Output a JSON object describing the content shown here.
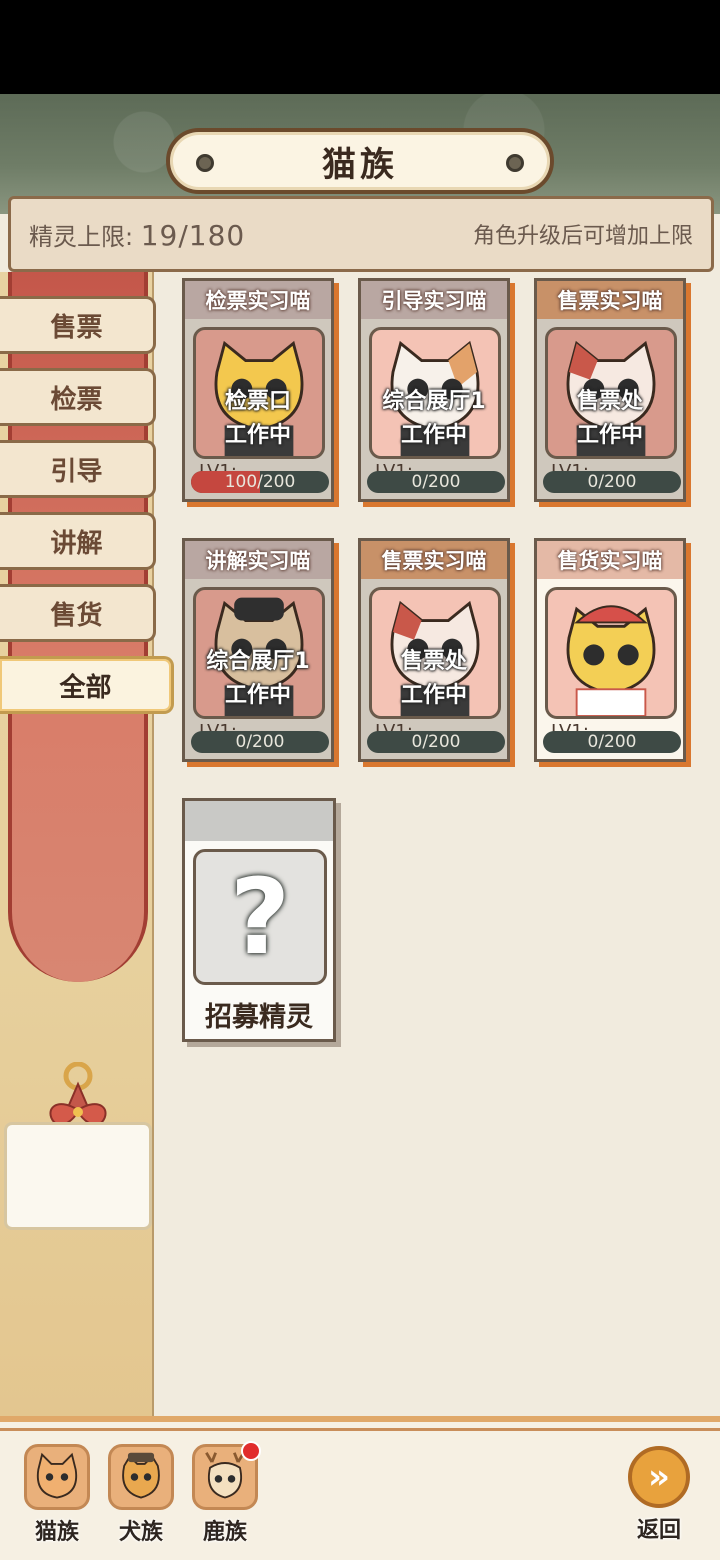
{
  "header": {
    "title": "猫族",
    "limit_label": "精灵上限:",
    "limit_value": "19/180",
    "limit_hint": "角色升级后可增加上限"
  },
  "sidebar": {
    "tabs": [
      {
        "label": "售票"
      },
      {
        "label": "检票"
      },
      {
        "label": "引导"
      },
      {
        "label": "讲解"
      },
      {
        "label": "售货"
      },
      {
        "label": "全部",
        "active": true
      }
    ]
  },
  "cards": [
    {
      "title": "检票实习喵",
      "location": "检票口",
      "status": "工作中",
      "level": "LV1:",
      "progress_text": "100/200",
      "progress": 0.5
    },
    {
      "title": "引导实习喵",
      "location": "综合展厅1",
      "status": "工作中",
      "level": "LV1:",
      "progress_text": "0/200",
      "progress": 0
    },
    {
      "title": "售票实习喵",
      "location": "售票处",
      "status": "工作中",
      "level": "LV1:",
      "progress_text": "0/200",
      "progress": 0
    },
    {
      "title": "讲解实习喵",
      "location": "综合展厅1",
      "status": "工作中",
      "level": "LV1:",
      "progress_text": "0/200",
      "progress": 0
    },
    {
      "title": "售票实习喵",
      "location": "售票处",
      "status": "工作中",
      "level": "LV1:",
      "progress_text": "0/200",
      "progress": 0
    },
    {
      "title": "售货实习喵",
      "level": "LV1:",
      "progress_text": "0/200",
      "progress": 0
    }
  ],
  "recruit": {
    "label": "招募精灵",
    "icon": "question-mark-icon"
  },
  "bottom_nav": {
    "items": [
      {
        "label": "猫族",
        "icon": "cat-icon"
      },
      {
        "label": "犬族",
        "icon": "dog-icon"
      },
      {
        "label": "鹿族",
        "icon": "deer-icon",
        "badge": true
      }
    ],
    "back_label": "返回",
    "back_icon": "chevron-right-icon"
  },
  "colors": {
    "accent_orange": "#d9772f",
    "banner_red": "#c4574a",
    "progress_red": "#c5473f",
    "notification": "#e12d2d"
  }
}
